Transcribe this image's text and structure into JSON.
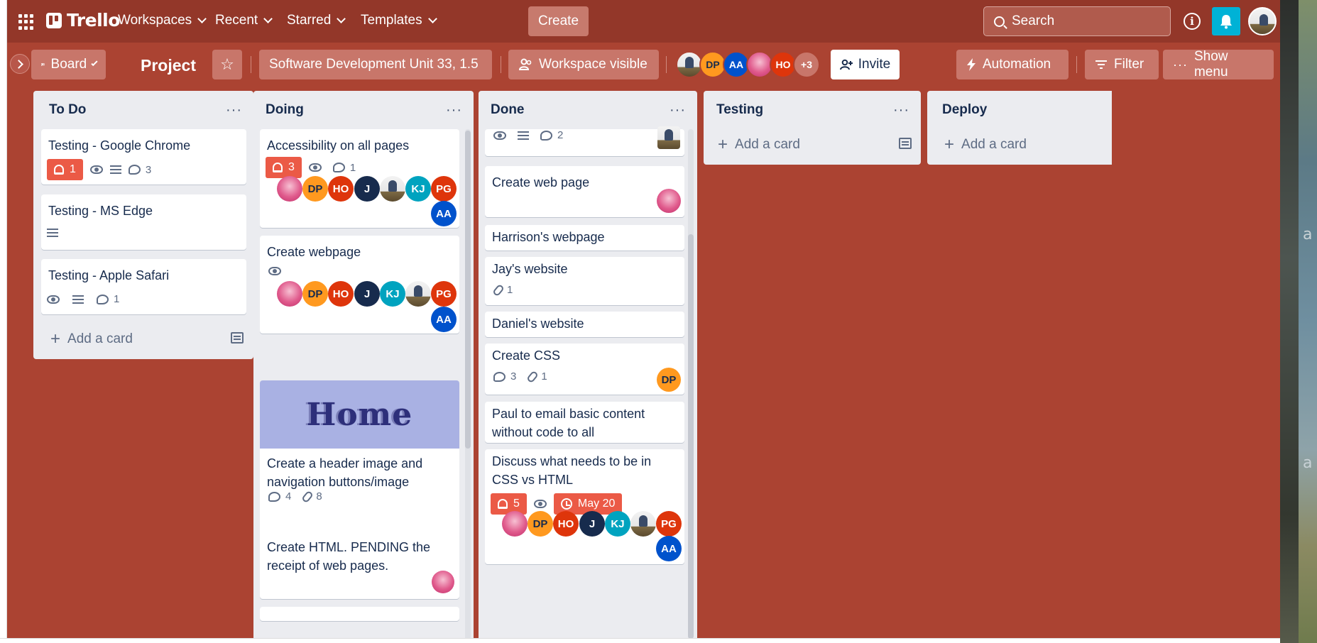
{
  "topnav": {
    "logo_text": "Trello",
    "workspaces": "Workspaces",
    "recent": "Recent",
    "starred": "Starred",
    "templates": "Templates",
    "create": "Create",
    "search_placeholder": "Search"
  },
  "boardbar": {
    "view": "Board",
    "title": "Project",
    "workspace_name": "Software Development Unit 33, 1.5",
    "visibility": "Workspace visible",
    "members": [
      "DP",
      "AA",
      "HO"
    ],
    "more_members": "+3",
    "invite": "Invite",
    "automation": "Automation",
    "filter": "Filter",
    "show_menu": "Show menu"
  },
  "lists": {
    "todo": {
      "title": "To Do",
      "add_card": "Add a card",
      "cards": [
        {
          "title": "Testing - Google Chrome",
          "notifications": "1",
          "comments": "3"
        },
        {
          "title": "Testing - MS Edge"
        },
        {
          "title": "Testing - Apple Safari",
          "comments": "1"
        }
      ]
    },
    "doing": {
      "title": "Doing",
      "cards": [
        {
          "title": "Accessibility on all pages",
          "notifications": "3",
          "comments": "1"
        },
        {
          "title": "Create webpage"
        },
        {
          "cover_text": "Home",
          "title": "Create a header image and navigation buttons/image",
          "comments": "4",
          "attachments": "8"
        },
        {
          "title": "Create HTML. PENDING the receipt of web pages."
        }
      ]
    },
    "done": {
      "title": "Done",
      "cards": [
        {
          "comments": "2"
        },
        {
          "title": "Create web page"
        },
        {
          "title": "Harrison's webpage"
        },
        {
          "title": "Jay's website",
          "attachments": "1"
        },
        {
          "title": "Daniel's website"
        },
        {
          "title": "Create CSS",
          "comments": "3",
          "attachments": "1"
        },
        {
          "title": "Paul to email basic content without code to all"
        },
        {
          "title": "Discuss what needs to be in CSS vs HTML",
          "notifications": "5",
          "due": "May 20"
        }
      ]
    },
    "testing": {
      "title": "Testing",
      "add_card": "Add a card"
    },
    "deploy": {
      "title": "Deploy",
      "add_card": "Add a card"
    }
  },
  "avatars": {
    "dp": "DP",
    "ho": "HO",
    "j": "J",
    "kj": "KJ",
    "pg": "PG",
    "aa": "AA"
  },
  "colors": {
    "board_bg": "#ab4332",
    "nav_bg": "#933729",
    "list_bg": "#ebecf0",
    "notification_red": "#eb5a46",
    "accent_cyan": "#00b2d6"
  }
}
